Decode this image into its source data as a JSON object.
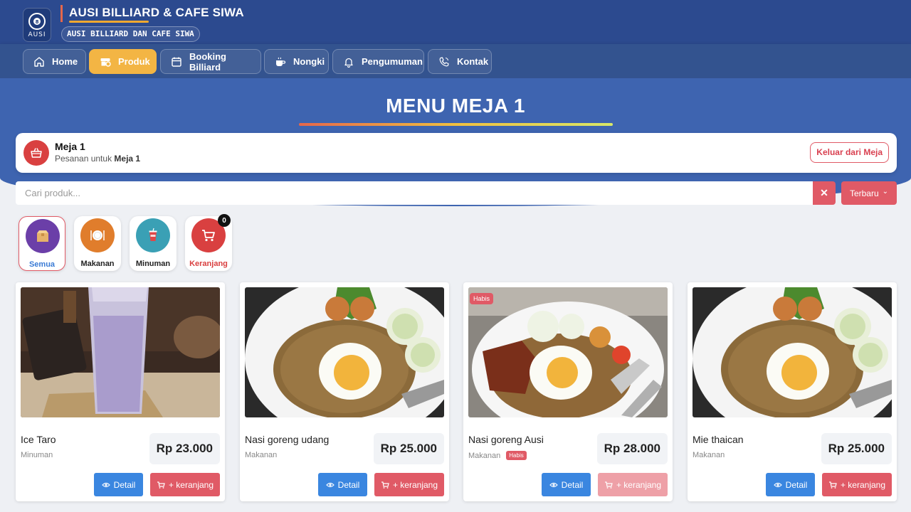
{
  "header": {
    "logo_text": "AUSI",
    "title": "AUSI BILLIARD & CAFE SIWA",
    "subtitle": "AUSI BILLIARD DAN CAFE SIWA"
  },
  "nav": {
    "home": "Home",
    "produk": "Produk",
    "booking": "Booking Billiard",
    "nongki": "Nongki",
    "pengumuman": "Pengumuman",
    "kontak": "Kontak"
  },
  "hero": {
    "title": "MENU MEJA 1"
  },
  "table": {
    "name": "Meja 1",
    "sub_prefix": "Pesanan untuk",
    "sub_table": "Meja 1",
    "leave_label": "Keluar dari Meja"
  },
  "search": {
    "placeholder": "Cari produk...",
    "clear_label": "✕",
    "sort_label": "Terbaru",
    "sort_caret": "⌄"
  },
  "categories": {
    "semua": "Semua",
    "makanan": "Makanan",
    "minuman": "Minuman",
    "keranjang": "Keranjang",
    "cart_count": "0"
  },
  "products": [
    {
      "name": "Ice Taro",
      "category": "Minuman",
      "price": "Rp 23.000",
      "detail": "Detail",
      "add": "+ keranjang"
    },
    {
      "name": "Nasi goreng udang",
      "category": "Makanan",
      "price": "Rp 25.000",
      "detail": "Detail",
      "add": "+ keranjang"
    },
    {
      "name": "Nasi goreng Ausi",
      "category": "Makanan",
      "price": "Rp 28.000",
      "detail": "Detail",
      "add": "+ keranjang",
      "status": "Habis"
    },
    {
      "name": "Mie thaican",
      "category": "Makanan",
      "price": "Rp 25.000",
      "detail": "Detail",
      "add": "+ keranjang"
    }
  ],
  "colors": {
    "header": "#2c4a8f",
    "hero": "#3e64b0",
    "accent_orange": "#f3b544",
    "accent_red": "#e05a66",
    "accent_blue": "#3a86e0"
  }
}
